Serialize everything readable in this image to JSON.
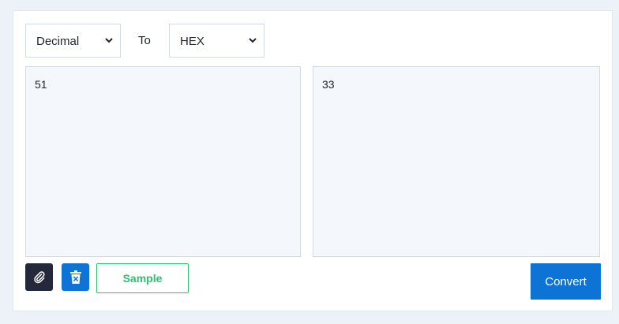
{
  "from_select": {
    "value": "Decimal"
  },
  "to_label": "To",
  "to_select": {
    "value": "HEX"
  },
  "input_area": {
    "value": "51"
  },
  "output_area": {
    "value": "33"
  },
  "buttons": {
    "attach_icon": "paperclip-icon",
    "clear_icon": "trash-icon",
    "sample_label": "Sample",
    "convert_label": "Convert"
  },
  "colors": {
    "page_bg": "#edf1f8",
    "attach_bg": "#23283b",
    "clear_bg": "#0d74d6",
    "sample_accent": "#2fbf71",
    "convert_bg": "#0d74d6",
    "textarea_bg": "#f4f7fb"
  }
}
